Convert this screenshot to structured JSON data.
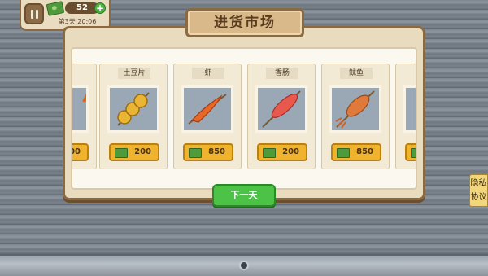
{
  "hud": {
    "money": "52",
    "add_label": "+",
    "day_time": "第3天 20:06"
  },
  "market": {
    "title": "进货市场",
    "items": [
      {
        "name": "",
        "price": "00",
        "icon": "partial-item"
      },
      {
        "name": "土豆片",
        "price": "200",
        "icon": "potato-skewer-icon"
      },
      {
        "name": "虾",
        "price": "850",
        "icon": "shrimp-skewer-icon"
      },
      {
        "name": "香肠",
        "price": "200",
        "icon": "sausage-skewer-icon"
      },
      {
        "name": "鱿鱼",
        "price": "850",
        "icon": "squid-skewer-icon"
      },
      {
        "name": "",
        "price": "",
        "icon": "partial-item"
      }
    ],
    "next_day": "下一天"
  },
  "privacy": {
    "label_line1": "隐私",
    "label_line2": "协议"
  },
  "colors": {
    "panel": "#e9dcbe",
    "border": "#8a6a43",
    "price_button": "#f0b32e",
    "next_button": "#4cc247"
  }
}
